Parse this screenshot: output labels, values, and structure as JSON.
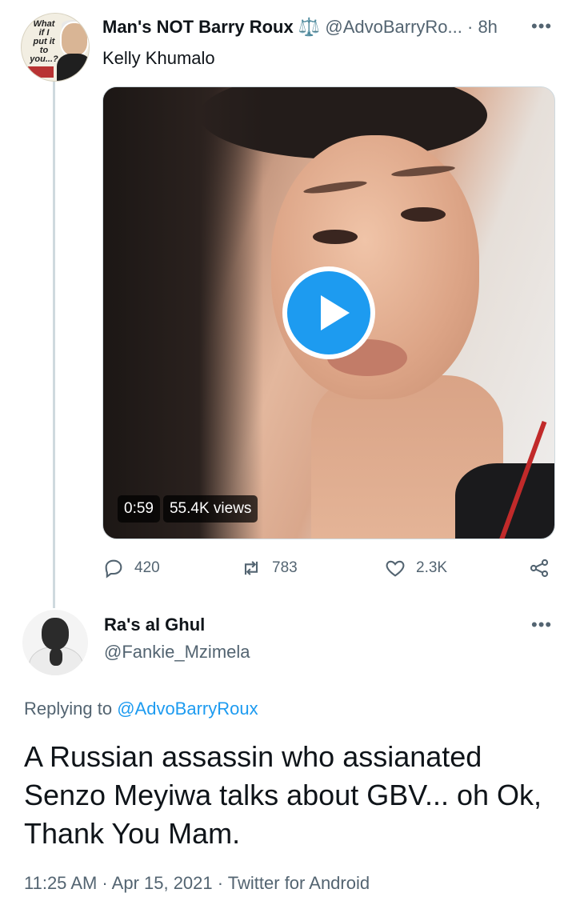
{
  "tweet": {
    "display_name": "Man's NOT Barry Roux ⚖️",
    "handle": "@AdvoBarryRo...",
    "separator": "·",
    "time_ago": "8h",
    "more_icon": "more-horizontal-icon",
    "text": "Kelly Khumalo",
    "avatar_caption_lines": [
      "What",
      "if I",
      "put it",
      "to you...?"
    ],
    "video": {
      "duration": "0:59",
      "views": "55.4K views",
      "play_icon": "play-icon"
    },
    "actions": {
      "replies": "420",
      "retweets": "783",
      "likes": "2.3K"
    }
  },
  "reply": {
    "display_name": "Ra's al Ghul",
    "handle": "@Fankie_Mzimela",
    "more_icon": "more-horizontal-icon",
    "replying_prefix": "Replying to",
    "replying_mention": "@AdvoBarryRoux",
    "text": "A Russian assassin who assianated Senzo Meyiwa talks about GBV... oh Ok, Thank You Mam.",
    "timestamp": "11:25 AM · Apr 15, 2021 · Twitter for Android"
  },
  "colors": {
    "accent": "#1d9bf0",
    "secondary_text": "#536471",
    "thread_line": "#cfd9de"
  }
}
